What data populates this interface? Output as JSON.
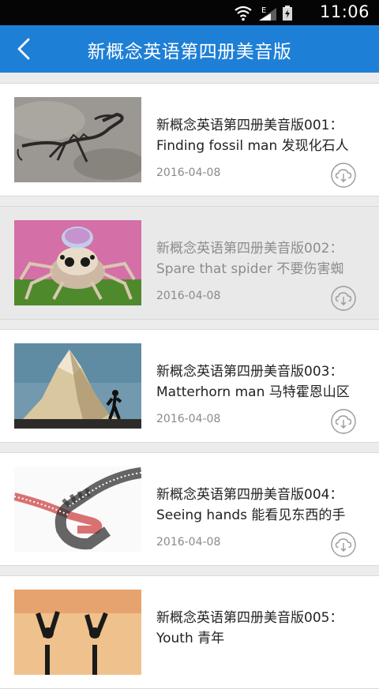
{
  "status_bar": {
    "time": "11:06",
    "network_label": "E",
    "icons": [
      "wifi-icon",
      "signal-icon",
      "battery-icon"
    ]
  },
  "app_bar": {
    "title": "新概念英语第四册美音版",
    "back_icon": "back-arrow-icon"
  },
  "list": {
    "items": [
      {
        "title_line1": "新概念英语第四册美音版001：",
        "title_line2": "Finding fossil man 发现化石人",
        "date": "2016-04-08",
        "thumbnail": "fossil",
        "selected": false
      },
      {
        "title_line1": "新概念英语第四册美音版002：",
        "title_line2": "Spare that spider 不要伤害蜘",
        "date": "2016-04-08",
        "thumbnail": "spider",
        "selected": true
      },
      {
        "title_line1": "新概念英语第四册美音版003：",
        "title_line2": "Matterhorn man 马特霍恩山区",
        "date": "2016-04-08",
        "thumbnail": "mountain",
        "selected": false
      },
      {
        "title_line1": "新概念英语第四册美音版004：",
        "title_line2": "Seeing hands 能看见东西的手",
        "date": "2016-04-08",
        "thumbnail": "hands",
        "selected": false
      },
      {
        "title_line1": "新概念英语第四册美音版005：",
        "title_line2": "Youth 青年",
        "date": "",
        "thumbnail": "youth",
        "selected": false
      }
    ]
  },
  "colors": {
    "app_bar": "#1e7fd6",
    "status_bar": "#050505",
    "background": "#ececec",
    "selected_row": "#e9e9e9"
  }
}
